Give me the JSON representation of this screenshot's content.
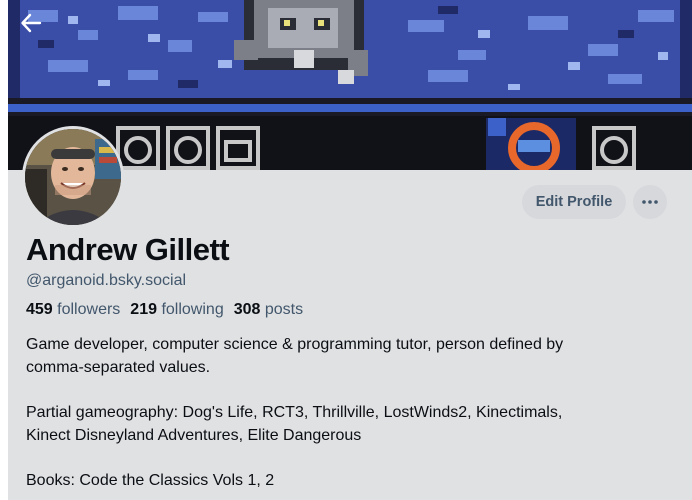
{
  "profile": {
    "display_name": "Andrew Gillett",
    "handle": "@arganoid.bsky.social",
    "stats": {
      "followers_count": "459",
      "followers_label": "followers",
      "following_count": "219",
      "following_label": "following",
      "posts_count": "308",
      "posts_label": "posts"
    },
    "bio": {
      "line1": "Game developer, computer science & programming tutor, person defined by",
      "line2": "comma-separated values.",
      "line3": "Partial gameography: Dog's Life, RCT3, Thrillville, LostWinds2, Kinectimals,",
      "line4": "Kinect Disneyland Adventures, Elite Dangerous",
      "line5": "Books: Code the Classics Vols 1, 2"
    }
  },
  "actions": {
    "edit_profile_label": "Edit Profile",
    "more_icon": "ellipsis-icon",
    "back_icon": "arrow-left-icon"
  },
  "colors": {
    "page_background": "#e0e1e3",
    "button_background": "#d6d8dc",
    "secondary_text": "#42576c",
    "primary_text": "#0b0f14"
  }
}
